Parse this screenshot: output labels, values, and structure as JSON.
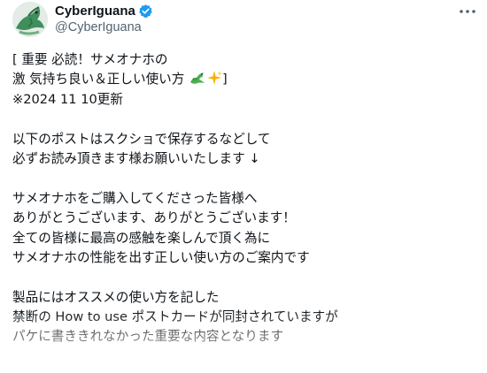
{
  "author": {
    "display_name": "CyberIguana",
    "handle": "@CyberIguana",
    "verified_color": "#1d9bf0"
  },
  "post": {
    "lines": [
      "[ 重要 必読！サメオナホの",
      " 激 気持ち良い＆正しい使い方 ",
      "※2024 11 10更新",
      "",
      "以下のポストはスクショで保存するなどして",
      "必ずお読み頂きます様お願いいたします ↓",
      "",
      "サメオナホをご購入してくださった皆様へ",
      "ありがとうございます、ありがとうございます！",
      "全ての皆様に最高の感触を楽しんで頂く為に",
      "サメオナホの性能を出す正しい使い方のご案内です",
      "",
      "製品にはオススメの使い方を記した",
      "禁断の How to use ポストカードが同封されていますが",
      "パケに書ききれなかった重要な内容となります"
    ],
    "line2_suffix": "]",
    "emojis": [
      "dragon-emoji",
      "sparkles-emoji"
    ]
  },
  "icons": [
    "avatar",
    "verified-badge-icon",
    "more-options-icon"
  ]
}
